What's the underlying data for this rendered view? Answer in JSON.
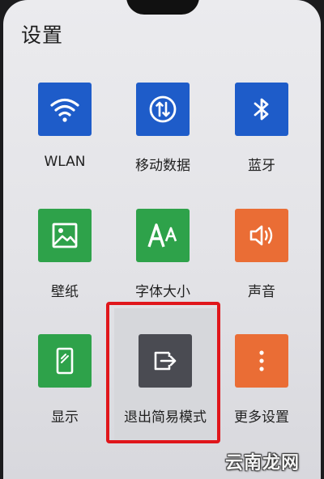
{
  "header": {
    "title": "设置"
  },
  "tiles": [
    {
      "label": "WLAN",
      "icon": "wifi-icon",
      "color": "#1e5cc9"
    },
    {
      "label": "移动数据",
      "icon": "mobile-data-icon",
      "color": "#1e5cc9"
    },
    {
      "label": "蓝牙",
      "icon": "bluetooth-icon",
      "color": "#1e5cc9"
    },
    {
      "label": "壁纸",
      "icon": "wallpaper-icon",
      "color": "#2ea24a"
    },
    {
      "label": "字体大小",
      "icon": "font-size-icon",
      "color": "#2ea24a"
    },
    {
      "label": "声音",
      "icon": "sound-icon",
      "color": "#ea6d35"
    },
    {
      "label": "显示",
      "icon": "display-icon",
      "color": "#2ea24a"
    },
    {
      "label": "退出简易模式",
      "icon": "exit-simple-mode-icon",
      "color": "#4a4b52"
    },
    {
      "label": "更多设置",
      "icon": "more-icon",
      "color": "#ea6d35"
    }
  ],
  "watermark": {
    "text": "云南龙网"
  }
}
